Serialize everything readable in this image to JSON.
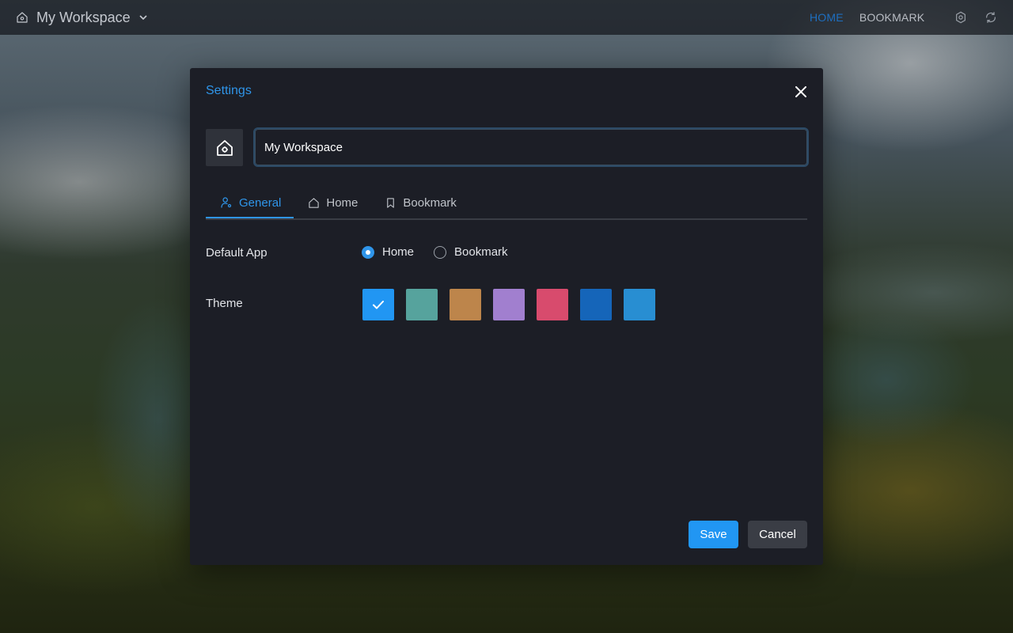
{
  "topbar": {
    "workspace_name": "My Workspace",
    "nav": [
      {
        "label": "HOME",
        "active": true
      },
      {
        "label": "BOOKMARK",
        "active": false
      }
    ],
    "icons": [
      "settings-icon",
      "refresh-icon"
    ]
  },
  "settings": {
    "title": "Settings",
    "workspace_name_value": "My Workspace",
    "tabs": [
      {
        "label": "General",
        "icon": "user-settings-icon",
        "active": true
      },
      {
        "label": "Home",
        "icon": "home-icon",
        "active": false
      },
      {
        "label": "Bookmark",
        "icon": "bookmark-icon",
        "active": false
      }
    ],
    "default_app": {
      "label": "Default App",
      "options": [
        {
          "label": "Home",
          "checked": true
        },
        {
          "label": "Bookmark",
          "checked": false
        }
      ]
    },
    "theme": {
      "label": "Theme",
      "swatches": [
        {
          "color": "#2196f3",
          "selected": true
        },
        {
          "color": "#56a39d",
          "selected": false
        },
        {
          "color": "#bd854b",
          "selected": false
        },
        {
          "color": "#a17fcf",
          "selected": false
        },
        {
          "color": "#d84b6d",
          "selected": false
        },
        {
          "color": "#1565b9",
          "selected": false
        },
        {
          "color": "#288ed2",
          "selected": false
        }
      ]
    },
    "buttons": {
      "save": "Save",
      "cancel": "Cancel"
    }
  },
  "colors": {
    "accent": "#2f95e9",
    "modal_bg": "#1c1e26",
    "cancel_bg": "#3a3d45"
  }
}
